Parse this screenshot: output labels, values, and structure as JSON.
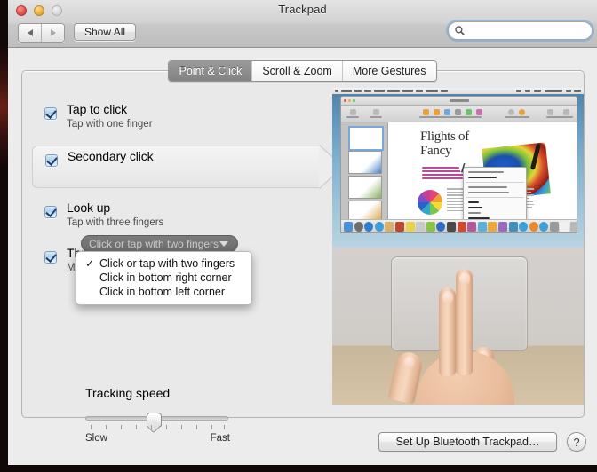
{
  "window": {
    "title": "Trackpad",
    "traffic_lights": {
      "close": "close-button",
      "minimize": "minimize-button",
      "zoom": "zoom-button"
    },
    "back_label": "◀",
    "forward_label": "▶",
    "show_all_label": "Show All"
  },
  "search": {
    "placeholder": "",
    "value": "",
    "icon": "search-icon"
  },
  "tabs": [
    {
      "label": "Point & Click",
      "selected": true
    },
    {
      "label": "Scroll & Zoom",
      "selected": false
    },
    {
      "label": "More Gestures",
      "selected": false
    }
  ],
  "options": [
    {
      "title": "Tap to click",
      "subtitle": "Tap with one finger",
      "checked": true
    },
    {
      "title": "Secondary click",
      "subtitle": "",
      "checked": true,
      "highlighted": true
    },
    {
      "title": "Look up",
      "subtitle": "Tap with three fingers",
      "checked": true
    },
    {
      "title": "Three finger drag",
      "subtitle": "Move with three fingers",
      "checked": true
    }
  ],
  "popup": {
    "selected_value": "Click or tap with two fingers",
    "arrow_icon": "chevron-down-icon",
    "menu_items": [
      {
        "label": "Click or tap with two fingers",
        "checked": true
      },
      {
        "label": "Click in bottom right corner",
        "checked": false
      },
      {
        "label": "Click in bottom left corner",
        "checked": false
      }
    ],
    "check_glyph": "✓"
  },
  "tracking": {
    "label": "Tracking speed",
    "min_label": "Slow",
    "max_label": "Fast",
    "value_percent": 45,
    "tick_count": 10
  },
  "preview": {
    "name": "trackpad-gesture-video",
    "document_title_line1": "Flights of",
    "document_title_line2": "Fancy"
  },
  "footer": {
    "bluetooth_button_label": "Set Up Bluetooth Trackpad…",
    "help_label": "?"
  },
  "colors": {
    "accent": "#68a4de",
    "window_bg": "#ececec",
    "content_bg": "#e9e9e9",
    "tab_selected_bg": "#8e8e8e",
    "checkbox_blue": "#a9cdeb",
    "check_mark": "#1f3d6b"
  }
}
